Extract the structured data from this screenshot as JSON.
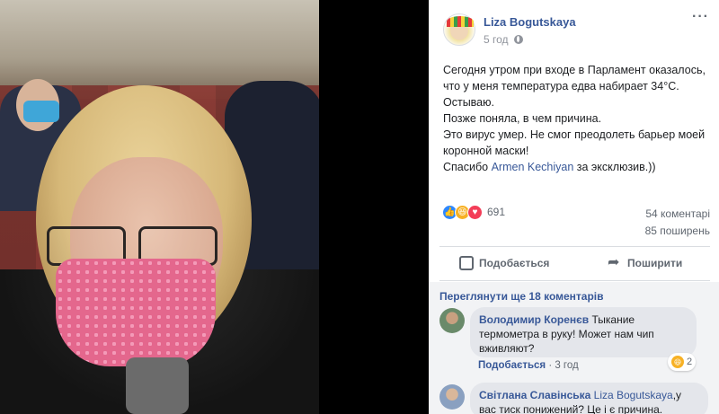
{
  "post": {
    "author": "Liza Bogutskaya",
    "time": "5 год",
    "text_lines": [
      "Сегодня утром при входе в Парламент оказалось,",
      "что у меня температура едва набирает 34°С.",
      "Остываю.",
      "Позже поняла, в чем причина.",
      "Это вирус умер. Не смог преодолеть барьер моей",
      "коронной маски!"
    ],
    "thanks_prefix": "Спасибо ",
    "thanks_mention": "Armen Kechiyan",
    "thanks_suffix": " за эксклюзив.))",
    "reaction_count": "691",
    "reactions": [
      "like-icon",
      "haha-icon",
      "love-icon"
    ],
    "comments_count": "54 коментарі",
    "shares_count": "85 поширень",
    "like_label": "Подобається",
    "share_label": "Поширити"
  },
  "comments": {
    "view_more": "Переглянути ще 18 коментарів",
    "items": [
      {
        "author": "Володимир Коренєв",
        "text_1": " Тыкание",
        "text_2": "термометра в руку! Может нам чип",
        "text_3": "вживляют?",
        "like_label": "Подобається",
        "time": " · 3 год",
        "reaction_count": "2"
      },
      {
        "author": "Світлана Славінська",
        "mention": "Liza Bogutskaya",
        "text_1": ",у",
        "text_2": "вас тиск понижений? Це і є причина."
      }
    ]
  },
  "colors": {
    "link": "#385898",
    "secondary": "#606770",
    "like_blue": "#2d88ff"
  }
}
